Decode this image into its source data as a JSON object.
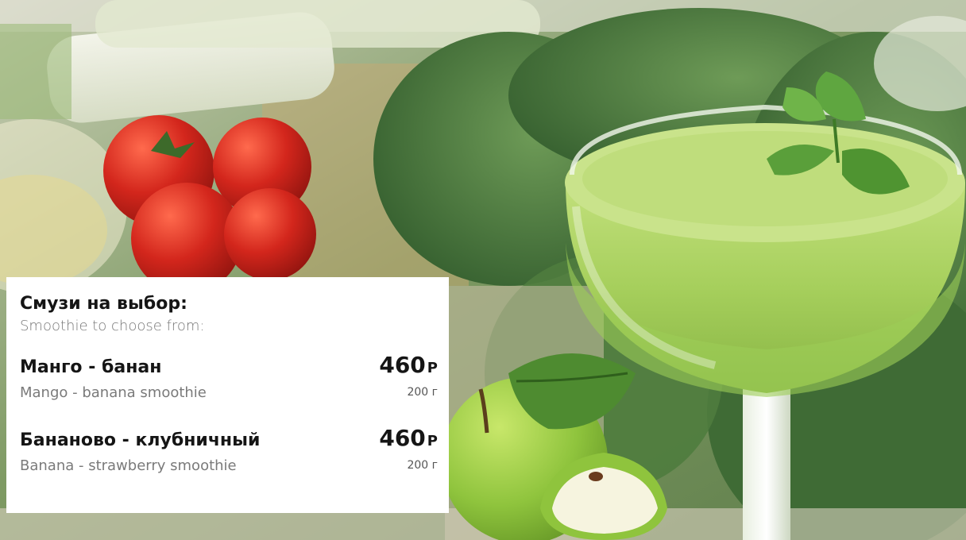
{
  "menu": {
    "title": "Смузи на выбор:",
    "subtitle": "Smoothie to choose from:",
    "items": [
      {
        "name": "Манго - банан",
        "description": "Mango - banana smoothie",
        "price": "460",
        "currency": "Р",
        "weight": "200 г"
      },
      {
        "name": "Бананово - клубничный",
        "description": "Banana - strawberry smoothie",
        "price": "460",
        "currency": "Р",
        "weight": "200 г"
      }
    ]
  },
  "colors": {
    "card_background": "#ffffff",
    "title_text": "#151515",
    "secondary_text": "#7a7a7a",
    "smoothie_green": "#a6cf5c",
    "apple_green": "#8fc43d",
    "tomato_red": "#d3261c",
    "leaf_dark_green": "#3f6b35"
  },
  "images": {
    "background": "food-photo-greens-tomatoes",
    "drink": "green-smoothie-glass-icon",
    "garnish": "mint-sprig-icon",
    "fruit": "green-apple-icon"
  }
}
